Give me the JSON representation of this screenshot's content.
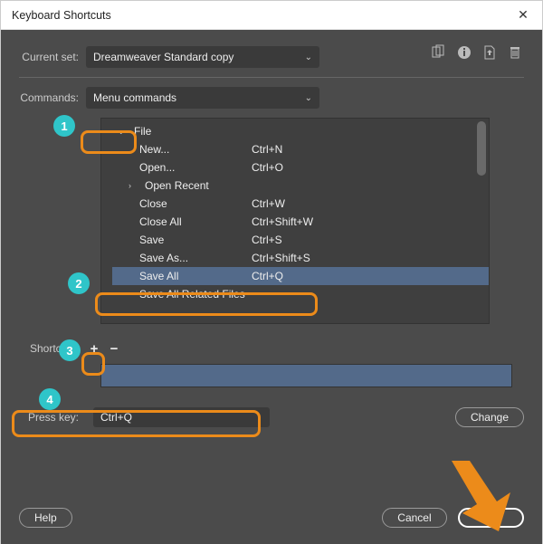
{
  "window": {
    "title": "Keyboard Shortcuts"
  },
  "currentSet": {
    "label": "Current set:",
    "value": "Dreamweaver Standard copy"
  },
  "commands": {
    "label": "Commands:",
    "value": "Menu commands"
  },
  "tree": {
    "rootLabel": "File",
    "items": [
      {
        "name": "New...",
        "shortcut": "Ctrl+N"
      },
      {
        "name": "Open...",
        "shortcut": "Ctrl+O"
      },
      {
        "name": "Open Recent",
        "shortcut": "",
        "hasChildren": true
      },
      {
        "name": "Close",
        "shortcut": "Ctrl+W"
      },
      {
        "name": "Close All",
        "shortcut": "Ctrl+Shift+W"
      },
      {
        "name": "Save",
        "shortcut": "Ctrl+S"
      },
      {
        "name": "Save As...",
        "shortcut": "Ctrl+Shift+S"
      },
      {
        "name": "Save All",
        "shortcut": "Ctrl+Q",
        "selected": true
      },
      {
        "name": "Save All Related Files",
        "shortcut": ""
      }
    ]
  },
  "shortcuts": {
    "label": "Shortcuts:"
  },
  "pressKey": {
    "label": "Press key:",
    "value": "Ctrl+Q",
    "changeLabel": "Change"
  },
  "buttons": {
    "help": "Help",
    "cancel": "Cancel",
    "ok": "OK"
  },
  "callouts": {
    "b1": "1",
    "b2": "2",
    "b3": "3",
    "b4": "4"
  }
}
